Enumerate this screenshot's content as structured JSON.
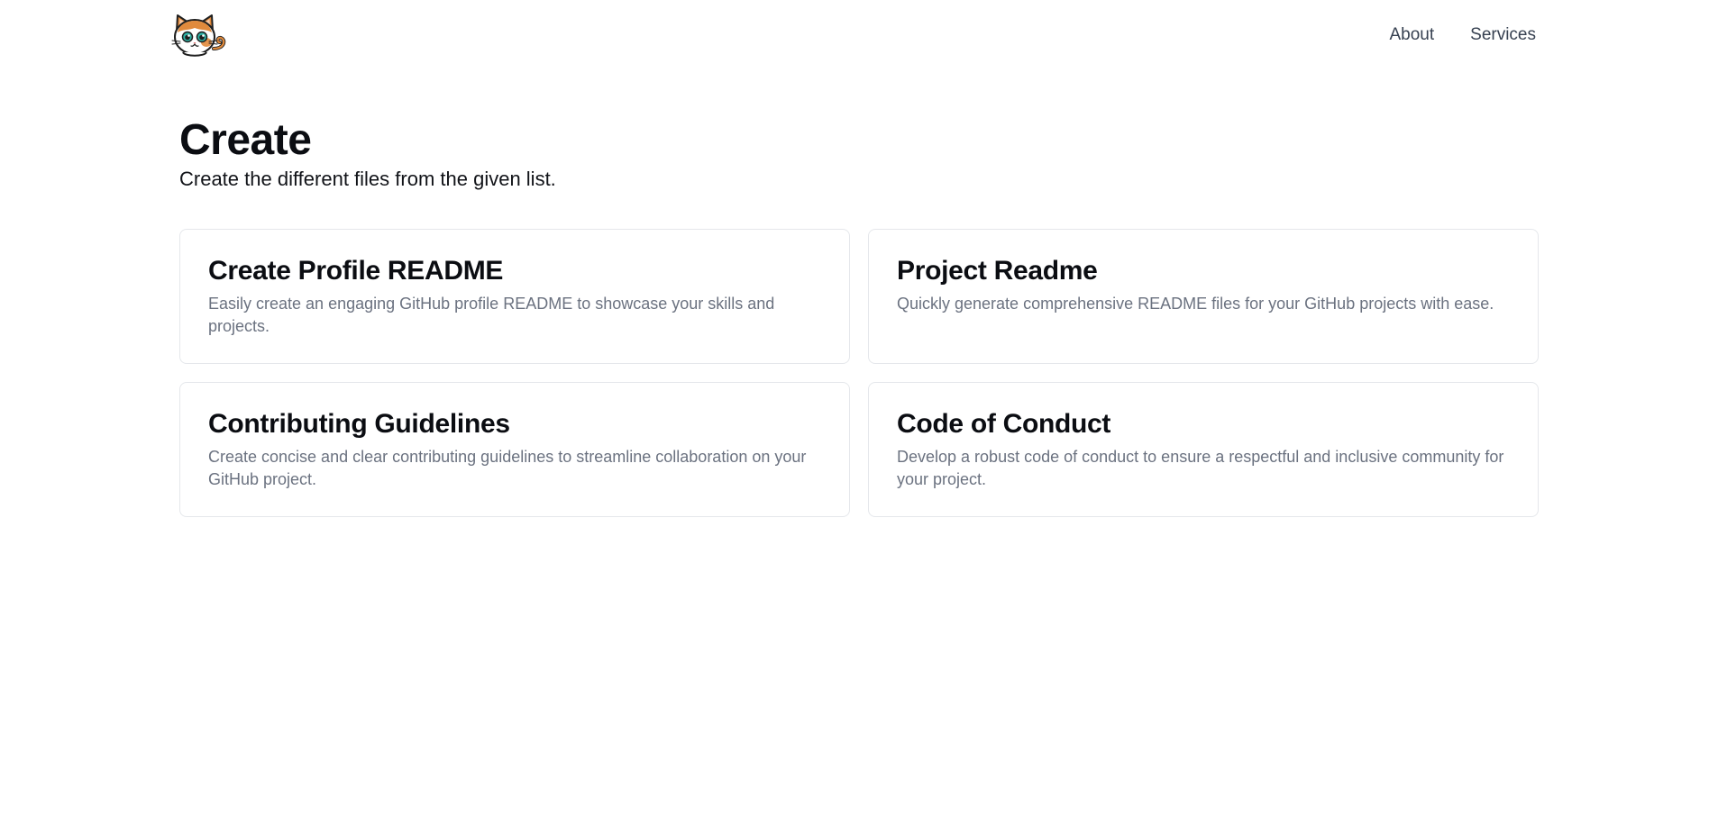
{
  "header": {
    "nav": [
      {
        "label": "About"
      },
      {
        "label": "Services"
      }
    ]
  },
  "hero": {
    "title": "Create",
    "subtitle": "Create the different files from the given list."
  },
  "cards": [
    {
      "title": "Create Profile README",
      "description": "Easily create an engaging GitHub profile README to showcase your skills and projects."
    },
    {
      "title": "Project Readme",
      "description": "Quickly generate comprehensive README files for your GitHub projects with ease."
    },
    {
      "title": "Contributing Guidelines",
      "description": "Create concise and clear contributing guidelines to streamline collaboration on your GitHub project."
    },
    {
      "title": "Code of Conduct",
      "description": "Develop a robust code of conduct to ensure a respectful and inclusive community for your project."
    }
  ],
  "colors": {
    "logo_orange": "#e08a3c",
    "logo_eye": "#2fb3a6",
    "card_border": "#e5e7eb",
    "muted_text": "#6b7280"
  },
  "icons": {
    "logo": "cat-logo-icon"
  }
}
